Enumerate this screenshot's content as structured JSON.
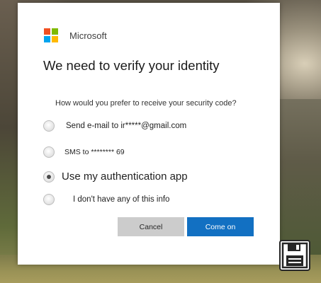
{
  "brand": {
    "name": "Microsoft",
    "logo_colors": [
      "#f25022",
      "#7fba00",
      "#00a4ef",
      "#ffb900"
    ]
  },
  "dialog": {
    "title": "We need to verify your identity",
    "question": "How would you prefer to receive your security code?",
    "options": [
      {
        "label": "Send e-mail to ir*****@gmail.com",
        "selected": false
      },
      {
        "label": "SMS to ******** 69",
        "selected": false
      },
      {
        "label": "Use my authentication app",
        "selected": true
      },
      {
        "label": "I don't have any of this info",
        "selected": false
      }
    ],
    "buttons": {
      "cancel": "Cancel",
      "confirm": "Come on"
    }
  },
  "colors": {
    "primary": "#1270c2",
    "secondary_button": "#cccccc",
    "dialog_bg": "#ffffff"
  },
  "icons": {
    "corner": "floppy-disk-save-icon"
  }
}
